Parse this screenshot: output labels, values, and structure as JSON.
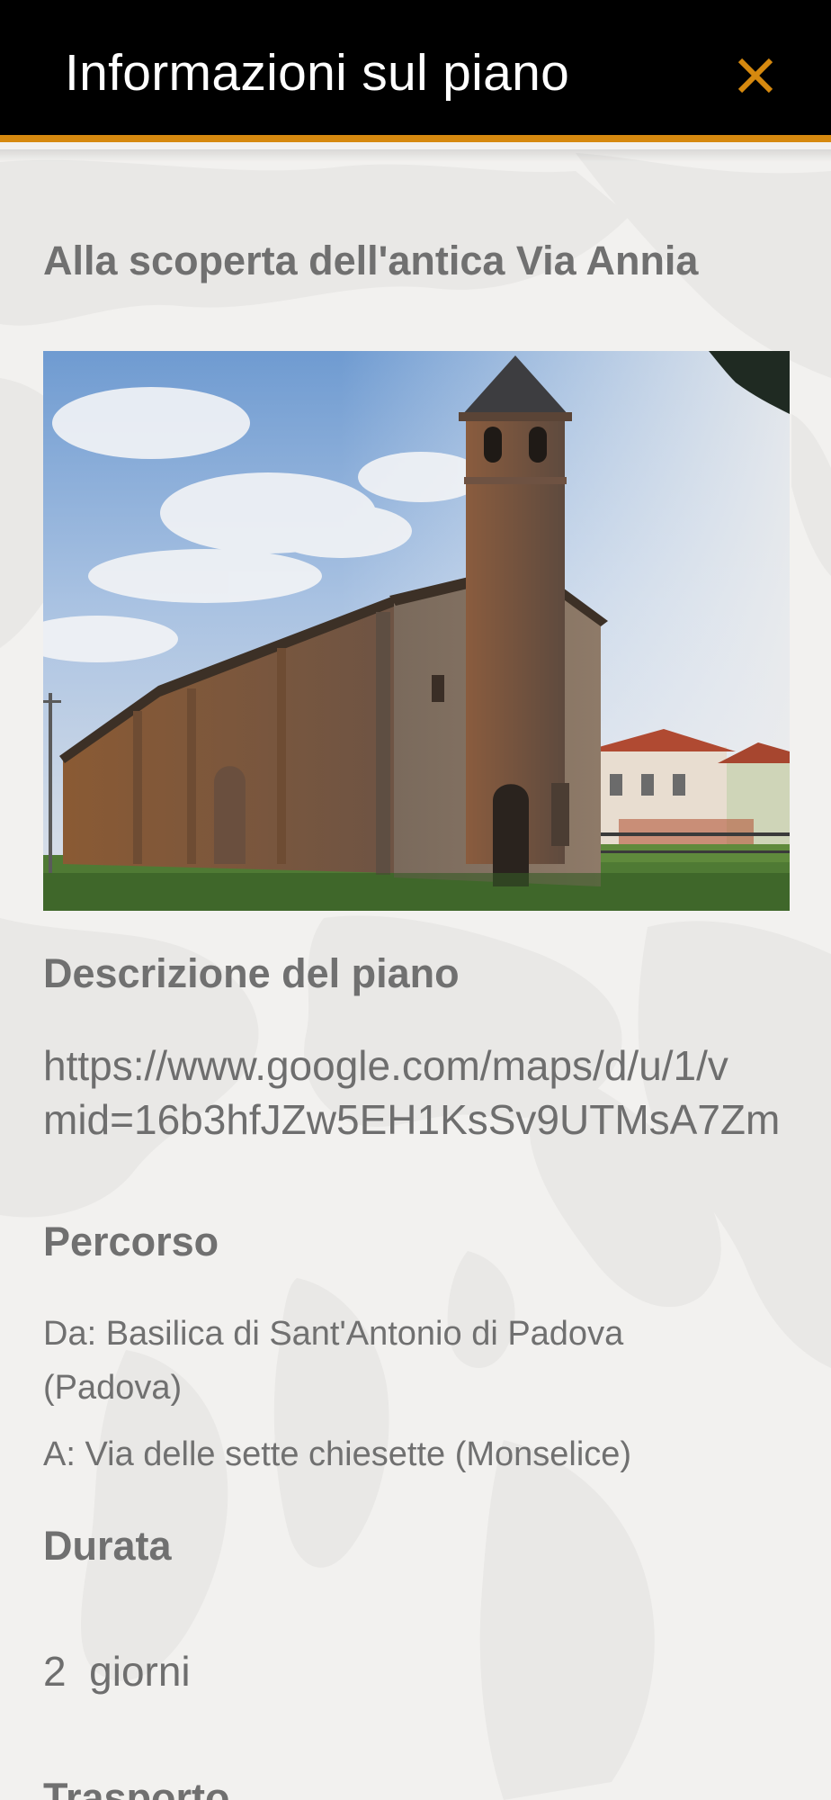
{
  "header": {
    "title": "Informazioni sul piano",
    "close_icon": "close-icon",
    "accent_color": "#d6890f"
  },
  "plan": {
    "title": "Alla scoperta dell'antica Via Annia",
    "photo": "church-with-bell-tower"
  },
  "description": {
    "heading": "Descrizione del piano",
    "lines": [
      "https://www.google.com/maps/d/u/1/v",
      "mid=16b3hfJZw5EH1KsSv9UTMsA7Zm"
    ]
  },
  "route": {
    "heading": "Percorso",
    "from": "Da: Basilica di Sant'Antonio di Padova (Padova)",
    "to": "A: Via delle sette chiesette (Monselice)"
  },
  "duration": {
    "heading": "Durata",
    "value": "2  giorni"
  },
  "transport": {
    "heading": "Trasporto"
  }
}
